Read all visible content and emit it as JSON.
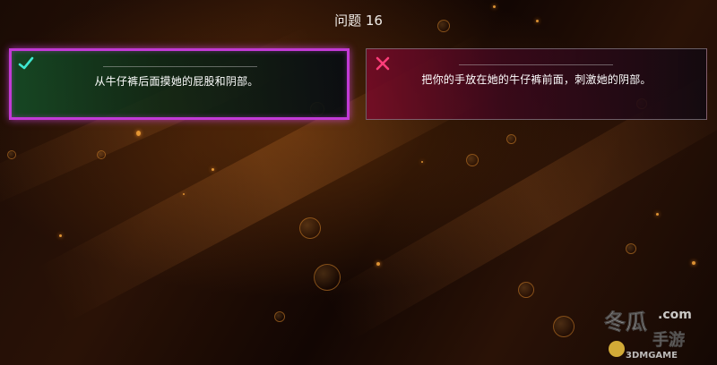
{
  "question": {
    "label": "问题 16"
  },
  "answers": [
    {
      "text": "从牛仔裤后面摸她的屁股和阴部。",
      "mark_icon": "check-icon",
      "state": "selected",
      "accent_color": "#3ee8d0",
      "border_color": "#c23ad6"
    },
    {
      "text": "把你的手放在她的牛仔裤前面，刺激她的阴部。",
      "mark_icon": "cross-icon",
      "state": "unselected",
      "accent_color": "#ff3d7a",
      "border_color": "#8c828c"
    }
  ],
  "watermark": {
    "brand_top": "冬瓜",
    "brand_domain": ".com",
    "brand_bottom": "手游",
    "brand_small": "3DMGAME"
  }
}
